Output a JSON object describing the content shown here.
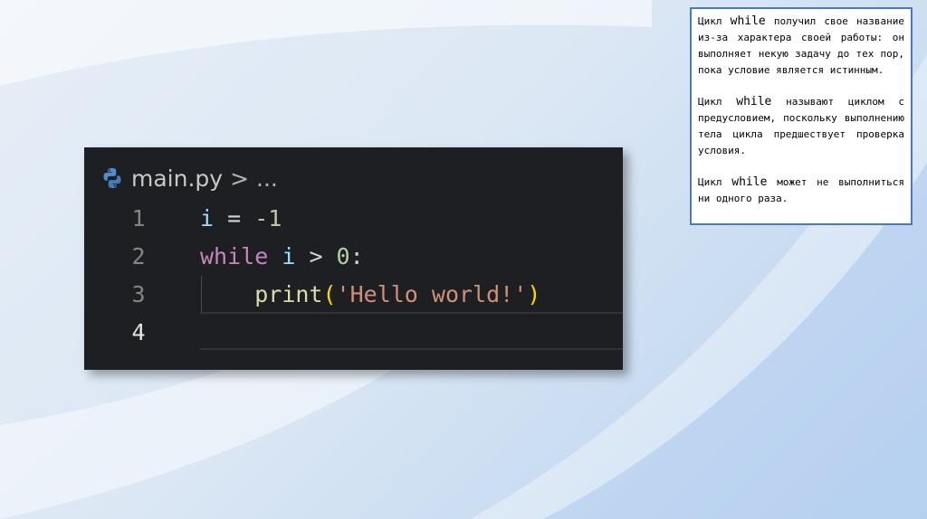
{
  "editor": {
    "breadcrumb": {
      "file": "main.py",
      "separator": ">",
      "more": "..."
    },
    "lines": [
      {
        "number": "1"
      },
      {
        "number": "2"
      },
      {
        "number": "3"
      },
      {
        "number": "4"
      }
    ],
    "code": {
      "line1": {
        "var": "i",
        "op": " = ",
        "num": "-1"
      },
      "line2": {
        "kw": "while",
        "var": "i",
        "op": " > ",
        "num": "0",
        "colon": ":"
      },
      "line3": {
        "indent": "    ",
        "fn": "print",
        "open": "(",
        "str": "'Hello world!'",
        "close": ")"
      }
    }
  },
  "info": {
    "p1": {
      "before": "Цикл ",
      "kw": "while",
      "after": " получил свое название из-за характера своей работы: он выполняет некую задачу до тех пор, пока условие является истинным."
    },
    "p2": {
      "before": "Цикл ",
      "kw": "while",
      "after": " называют циклом с предусловием, поскольку выполнению тела цикла предшествует проверка условия."
    },
    "p3": {
      "before": "Цикл ",
      "kw": "while",
      "after": " может не выполниться ни одного раза."
    }
  },
  "colors": {
    "keyword": "#c586c0",
    "variable": "#9cdcfe",
    "number": "#b5cea8",
    "function": "#dcdcaa",
    "string": "#ce9178",
    "editor_bg": "#1e1f22",
    "info_border": "#4a78c4"
  },
  "icons": {
    "file_icon": "python-icon"
  }
}
